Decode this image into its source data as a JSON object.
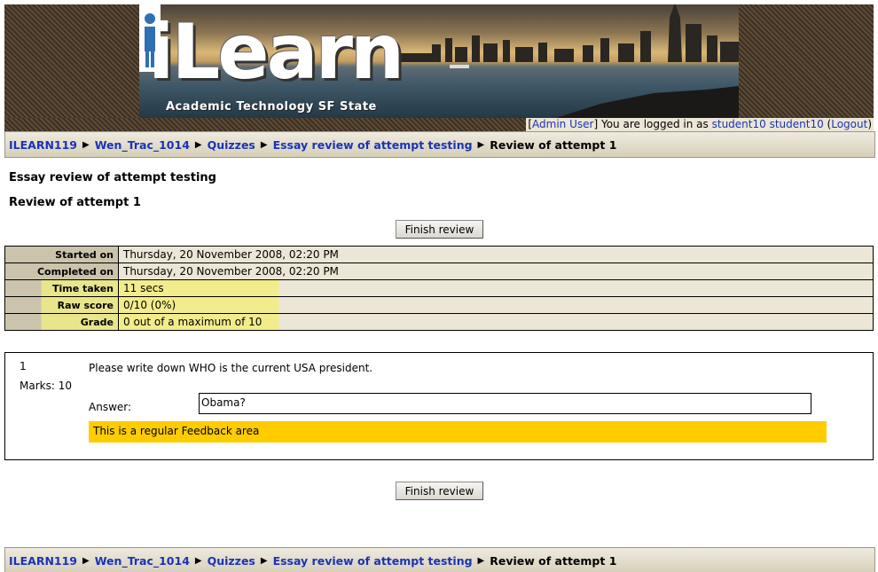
{
  "brand": {
    "logo_text": "iLearn",
    "tagline": "Academic Technology SF State"
  },
  "login": {
    "admin_user": "Admin User",
    "logged_in_text": "You are logged in as",
    "user_name": "student10 student10",
    "logout": "Logout"
  },
  "breadcrumb": {
    "items": [
      {
        "label": "ILEARN119"
      },
      {
        "label": "Wen_Trac_1014"
      },
      {
        "label": "Quizzes"
      },
      {
        "label": "Essay review of attempt testing"
      }
    ],
    "current": "Review of attempt 1"
  },
  "page": {
    "quiz_title": "Essay review of attempt testing",
    "subtitle": "Review of attempt 1",
    "finish_review": "Finish review"
  },
  "summary": {
    "rows": [
      {
        "label": "Started on",
        "value": "Thursday, 20 November 2008, 02:20 PM"
      },
      {
        "label": "Completed on",
        "value": "Thursday, 20 November 2008, 02:20 PM"
      },
      {
        "label": "Time taken",
        "value": "11 secs"
      },
      {
        "label": "Raw score",
        "value": "0/10 (0%)"
      },
      {
        "label": "Grade",
        "value": "0 out of a maximum of 10"
      }
    ]
  },
  "question": {
    "number": "1",
    "marks": "Marks: 10",
    "text": "Please write down WHO is the current USA president.",
    "answer_label": "Answer:",
    "answer_value": "Obama?",
    "feedback": "This is a regular Feedback area"
  },
  "colors": {
    "link": "#1a33b8",
    "feedback_bg": "#ffcc00",
    "highlight": "#f2ec8c",
    "label_bg": "#cbc3ac",
    "value_bg": "#ece6d6"
  }
}
